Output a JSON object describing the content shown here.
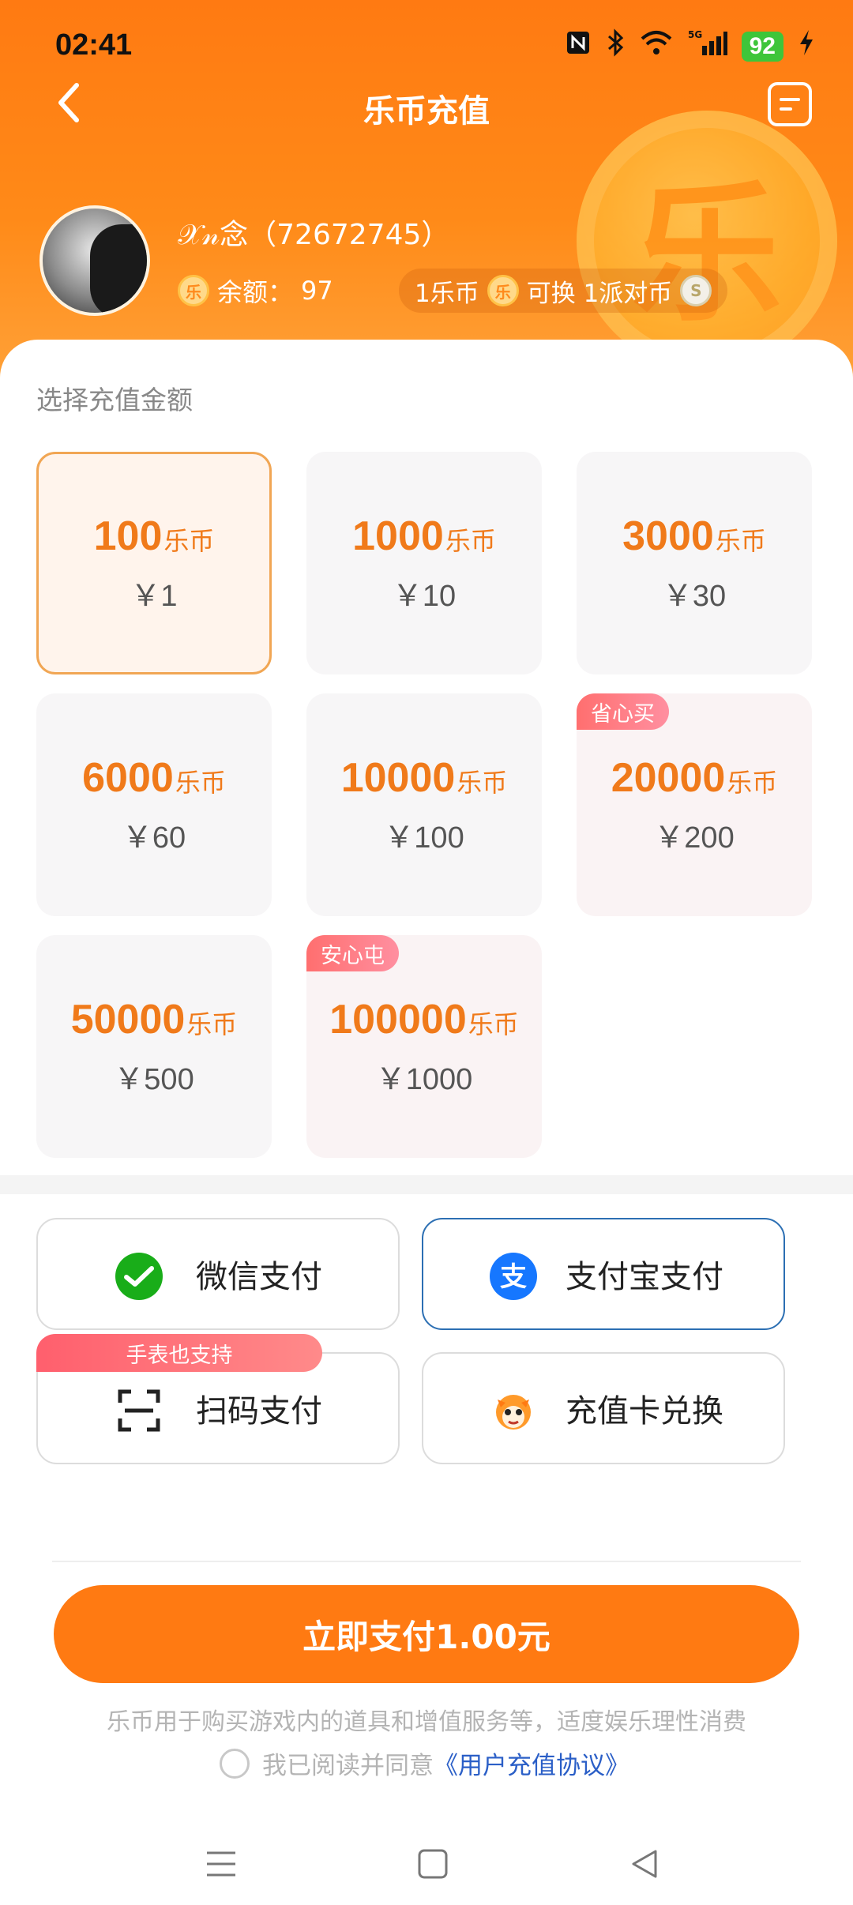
{
  "status_bar": {
    "time": "02:41",
    "battery": "92",
    "network": "5G"
  },
  "header": {
    "title": "乐币充值",
    "user": {
      "name": "𝒳𝓃念",
      "id": "（72672745）"
    },
    "balance_label": "余额：",
    "balance_value": "97",
    "exchange": {
      "left": "1乐币",
      "middle": "可换 1派对币"
    },
    "coin_glyph": "乐"
  },
  "select_label": "选择充值金额",
  "amounts": [
    {
      "coins": "100",
      "unit": "乐币",
      "price": "￥1",
      "tag": "",
      "selected": true
    },
    {
      "coins": "1000",
      "unit": "乐币",
      "price": "￥10",
      "tag": ""
    },
    {
      "coins": "3000",
      "unit": "乐币",
      "price": "￥30",
      "tag": ""
    },
    {
      "coins": "6000",
      "unit": "乐币",
      "price": "￥60",
      "tag": ""
    },
    {
      "coins": "10000",
      "unit": "乐币",
      "price": "￥100",
      "tag": ""
    },
    {
      "coins": "20000",
      "unit": "乐币",
      "price": "￥200",
      "tag": "省心买"
    },
    {
      "coins": "50000",
      "unit": "乐币",
      "price": "￥500",
      "tag": ""
    },
    {
      "coins": "100000",
      "unit": "乐币",
      "price": "￥1000",
      "tag": "安心屯"
    }
  ],
  "payment": {
    "wechat": "微信支付",
    "alipay": "支付宝支付",
    "scan": "扫码支付",
    "scan_tag": "手表也支持",
    "card": "充值卡兑换",
    "selected": "alipay"
  },
  "pay_button": "立即支付1.00元",
  "note": "乐币用于购买游戏内的道具和增值服务等，适度娱乐理性消费",
  "agreement": {
    "text": "我已阅读并同意",
    "link": "《用户充值协议》"
  },
  "colors": {
    "accent": "#ff7a12",
    "coin_text": "#f07a1a",
    "alipay_blue": "#1677ff",
    "wechat_green": "#19ad19"
  }
}
